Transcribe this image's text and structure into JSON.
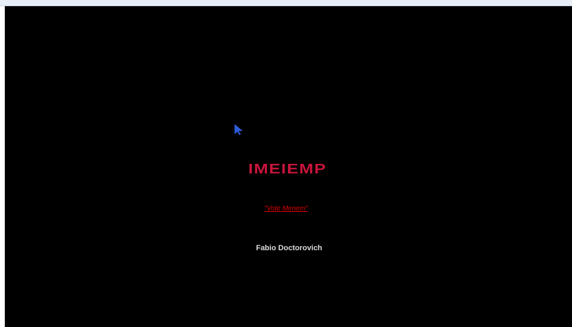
{
  "logo": {
    "text": "IMEIEMP",
    "color": "#c7153b"
  },
  "link": {
    "label": "\"Vote Menem\"",
    "color": "#e00000"
  },
  "author": {
    "name": "Fabio Doctorovich"
  },
  "cursor": {
    "icon": "mouse-pointer-icon",
    "color": "#2b5bd9"
  },
  "colors": {
    "background": "#000000",
    "top_strip": "#e8eef6"
  }
}
